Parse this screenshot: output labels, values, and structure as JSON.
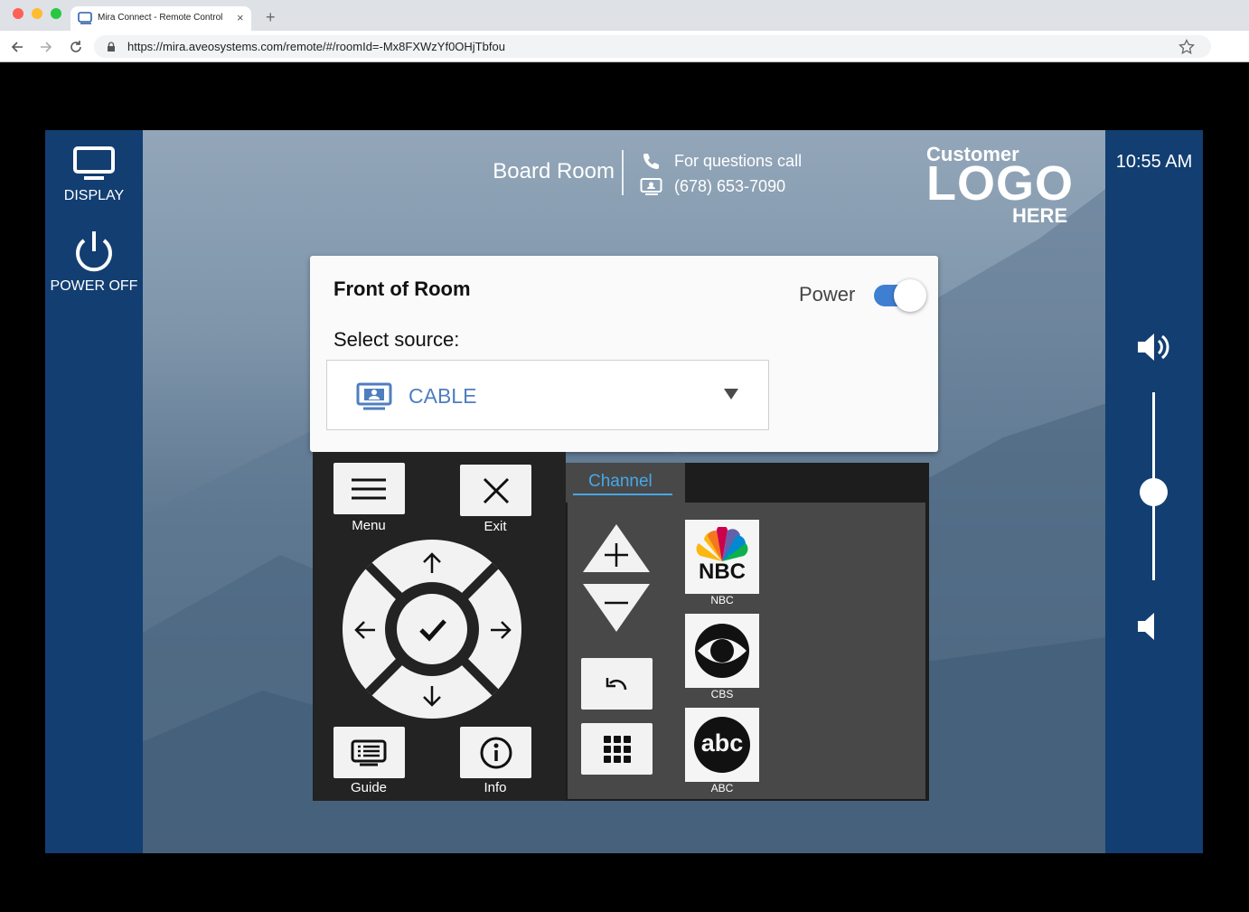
{
  "browser": {
    "tab_title": "Mira Connect - Remote Control",
    "tab_close": "×",
    "new_tab": "+",
    "url": "https://mira.aveosystems.com/remote/#/roomId=-Mx8FXWzYf0OHjTbfou"
  },
  "left_nav": {
    "display_label": "DISPLAY",
    "power_off_label": "POWER OFF"
  },
  "header": {
    "room_name": "Board Room",
    "questions_label": "For questions call",
    "phone": "(678) 653-7090",
    "logo": {
      "line1": "Customer",
      "line2": "LOGO",
      "line3": "HERE"
    }
  },
  "clock": "10:55 AM",
  "volume": {
    "level": 0.47
  },
  "panel": {
    "title": "Front of Room",
    "power_label": "Power",
    "power_on": true,
    "select_label": "Select source:",
    "source_value": "CABLE"
  },
  "remote": {
    "menu_label": "Menu",
    "exit_label": "Exit",
    "guide_label": "Guide",
    "info_label": "Info"
  },
  "channel": {
    "tab_label": "Channel",
    "networks": [
      {
        "name": "NBC",
        "logo_text": "NBC"
      },
      {
        "name": "CBS"
      },
      {
        "name": "ABC",
        "logo_text": "abc"
      }
    ]
  },
  "colors": {
    "nav_blue": "#123e72",
    "accent": "#3f7fd1",
    "source_text": "#4f7ebf",
    "channel_tab": "#48a7e6"
  }
}
